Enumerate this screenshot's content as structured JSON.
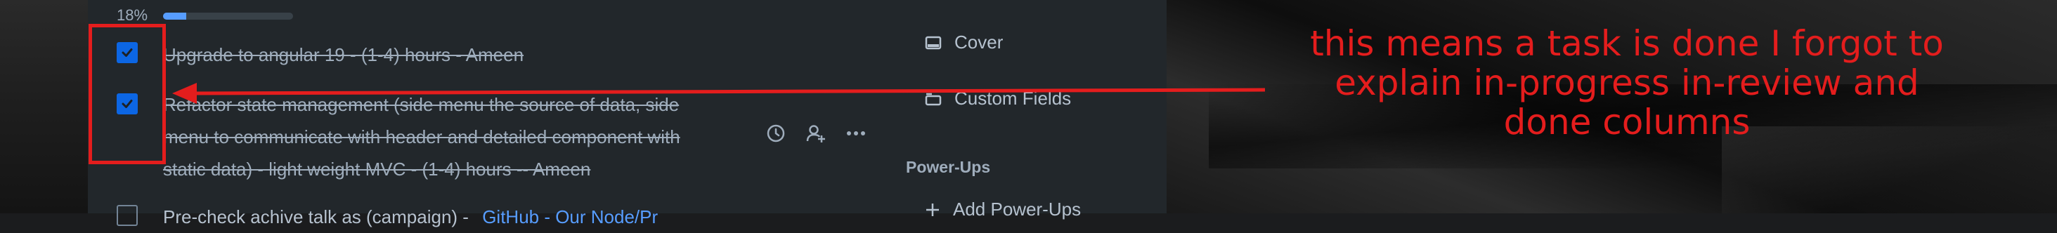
{
  "checklist": {
    "progress_label": "18%",
    "progress_percent": 18,
    "items": [
      {
        "text": "Upgrade to angular 19 - (1-4) hours - Ameen",
        "checked": true
      },
      {
        "text_lines": [
          "Refactor state management (side menu the source of data, side",
          "menu to communicate with header and detailed component with",
          "static data) - light weight MVC - (1-4) hours -- Ameen"
        ],
        "checked": true
      },
      {
        "text": "Pre-check achive talk as (campaign) -",
        "link": "GitHub - Our Node/Pr",
        "checked": false
      }
    ],
    "row_actions": [
      "clock-icon",
      "assign-member-icon",
      "more-icon"
    ]
  },
  "side_panel": {
    "cover_label": "Cover",
    "custom_fields_label": "Custom Fields",
    "power_ups_heading": "Power-Ups",
    "add_power_ups_label": "Add Power-Ups"
  },
  "annotation": {
    "lines": [
      "this means a task is done I forgot to",
      "explain in-progress in-review and",
      "done columns"
    ],
    "color": "#e41d1d"
  },
  "colors": {
    "checkbox_checked": "#0c66e4",
    "progress_fill": "#579dff",
    "card_bg": "#22272b"
  }
}
